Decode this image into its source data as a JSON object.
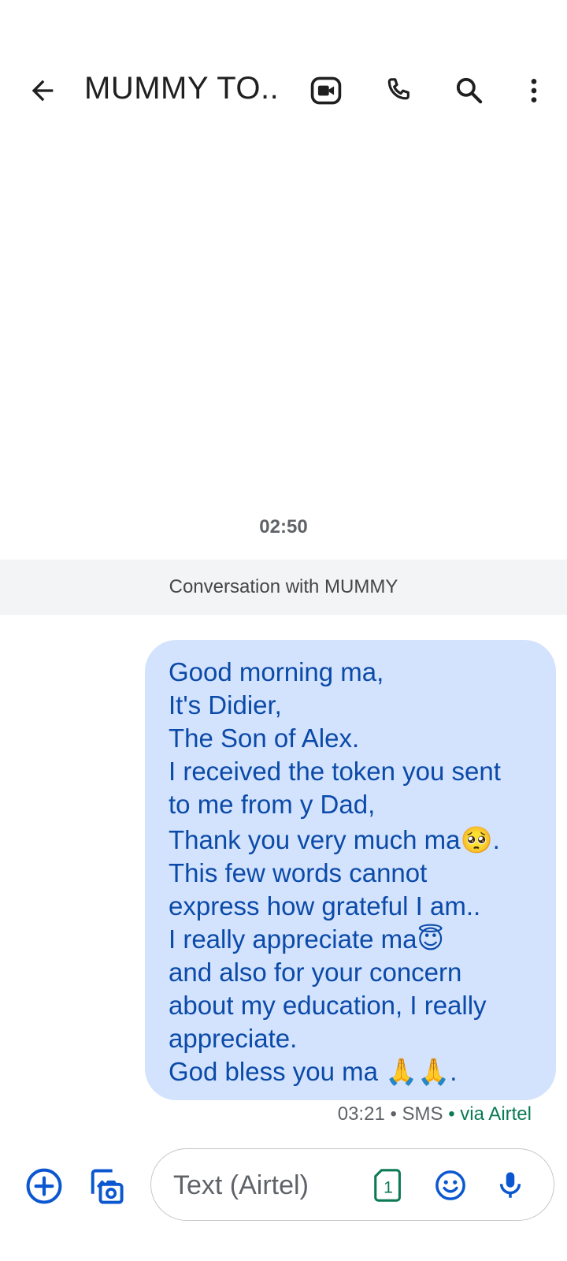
{
  "header": {
    "title": "MUMMY TO..."
  },
  "conversation": {
    "timestamp": "02:50",
    "banner": "Conversation with MUMMY"
  },
  "message": {
    "lines": [
      "Good morning ma,",
      "It's Didier,",
      "The Son of Alex.",
      "I received the token you sent",
      "to me from y Dad,",
      "Thank you very much ma🥺.",
      "This few words cannot",
      "express how grateful I am..",
      "I really appreciate ma😇",
      "and also for your concern",
      "about my education, I really",
      "appreciate.",
      "God bless you ma 🙏🙏."
    ],
    "meta_time": "03:21 • SMS",
    "meta_via": " • via Airtel"
  },
  "composer": {
    "placeholder": "Text (Airtel)",
    "sim_label": "1"
  },
  "icons": {
    "back": "arrow-back-icon",
    "video": "video-call-icon",
    "call": "phone-icon",
    "search": "search-icon",
    "more": "more-vert-icon",
    "add": "add-circle-icon",
    "gallery": "gallery-camera-icon",
    "sim": "sim-card-icon",
    "emoji": "emoji-icon",
    "mic": "mic-icon"
  },
  "colors": {
    "bubble_bg": "#d3e3fd",
    "bubble_text": "#0b4aa8",
    "accent_blue": "#0b57d0",
    "sim_green": "#0b7a55"
  }
}
